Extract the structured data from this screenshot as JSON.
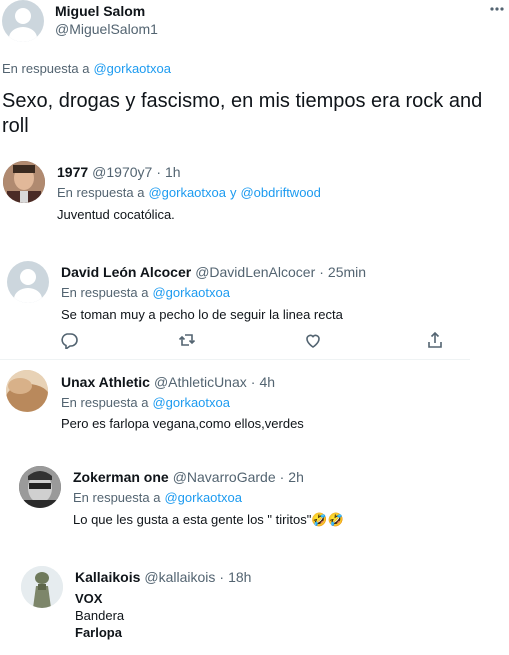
{
  "main_tweet": {
    "name": "Miguel Salom",
    "handle": "@MiguelSalom1",
    "reply_prefix": "En respuesta a",
    "reply_to": "@gorkaotxoa",
    "text": "Sexo, drogas y fascismo, en mis tiempos era rock and roll"
  },
  "replies": [
    {
      "name": "1977",
      "handle": "@1970y7",
      "time": "1h",
      "reply_prefix": "En respuesta a",
      "reply_to_1": "@gorkaotxoa",
      "reply_join": "y",
      "reply_to_2": "@obdriftwood",
      "text": "Juventud cocatólica."
    },
    {
      "name": "David León Alcocer",
      "handle": "@DavidLenAlcocer",
      "time": "25min",
      "reply_prefix": "En respuesta a",
      "reply_to": "@gorkaotxoa",
      "text": "Se toman muy a pecho lo de seguir la linea recta"
    },
    {
      "name": "Unax Athletic",
      "handle": "@AthleticUnax",
      "time": "4h",
      "reply_prefix": "En respuesta a",
      "reply_to": "@gorkaotxoa",
      "text": "Pero es farlopa vegana,como ellos,verdes"
    },
    {
      "name": "Zokerman one",
      "handle": "@NavarroGarde",
      "time": "2h",
      "reply_prefix": "En respuesta a",
      "reply_to": "@gorkaotxoa",
      "text": "Lo que les gusta a esta gente los \" tiritos\"",
      "emoji": "🤣🤣"
    },
    {
      "name": "Kallaikois",
      "handle": "@kallaikois",
      "time": "18h",
      "lines": [
        "VOX",
        "Bandera",
        "Farlopa"
      ]
    }
  ],
  "sep": "·",
  "icons": {
    "more": "more-icon",
    "reply": "reply-icon",
    "retweet": "retweet-icon",
    "like": "like-icon",
    "share": "share-icon"
  },
  "colors": {
    "link": "#1d9bf0",
    "muted": "#536471",
    "text": "#0f1419"
  }
}
